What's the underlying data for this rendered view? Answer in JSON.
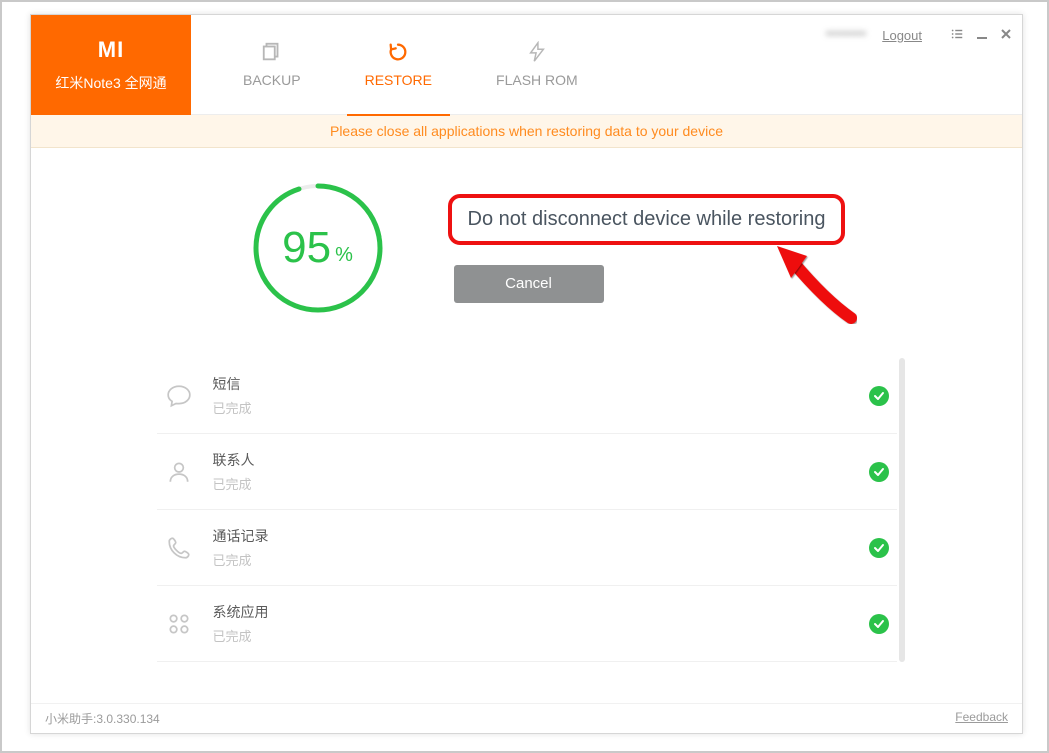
{
  "header": {
    "device_name": "红米Note3 全网通",
    "tabs": {
      "backup": "BACKUP",
      "restore": "RESTORE",
      "flash_rom": "FLASH ROM"
    },
    "user_label": "********",
    "logout_label": "Logout"
  },
  "notice": "Please close all applications when restoring data to your device",
  "progress": {
    "percent": 95,
    "percent_symbol": "%",
    "warning": "Do not disconnect device while restoring",
    "cancel_label": "Cancel"
  },
  "items": [
    {
      "icon": "chat",
      "title": "短信",
      "sub": "已完成"
    },
    {
      "icon": "person",
      "title": "联系人",
      "sub": "已完成"
    },
    {
      "icon": "phone",
      "title": "通话记录",
      "sub": "已完成"
    },
    {
      "icon": "apps",
      "title": "系统应用",
      "sub": "已完成"
    }
  ],
  "footer": {
    "version_label": "小米助手:3.0.330.134",
    "feedback_label": "Feedback"
  },
  "colors": {
    "accent": "#ff6900",
    "success": "#2bc24a",
    "highlight_border": "#e11"
  }
}
